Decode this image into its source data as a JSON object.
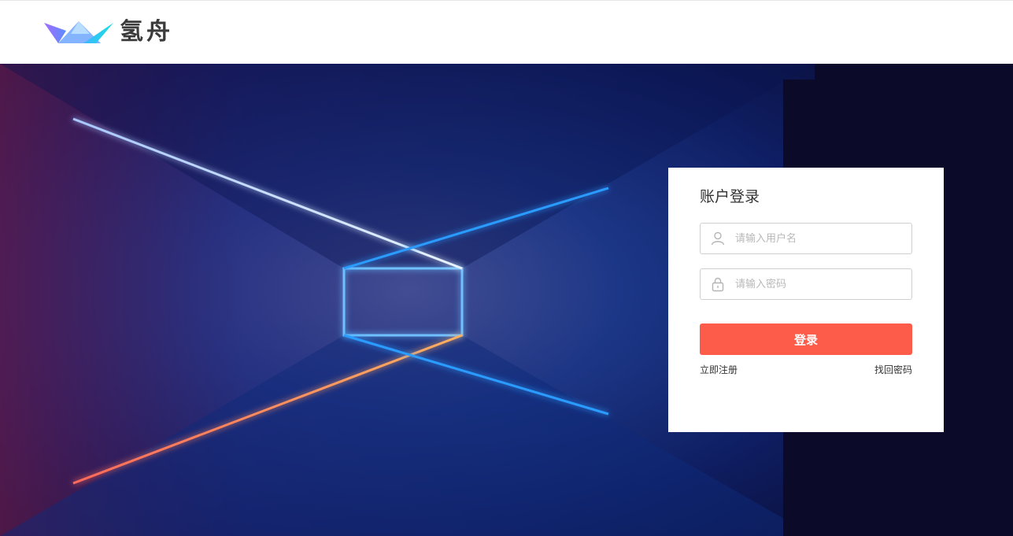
{
  "header": {
    "brand_name": "氢舟",
    "logo_icon": "paper-boat-logo"
  },
  "login": {
    "title": "账户登录",
    "username": {
      "placeholder": "请输入用户名",
      "value": "",
      "icon": "user-icon"
    },
    "password": {
      "placeholder": "请输入密码",
      "value": "",
      "icon": "lock-icon"
    },
    "submit_label": "登录",
    "register_link": "立即注册",
    "forgot_link": "找回密码"
  },
  "colors": {
    "accent": "#fe5c4b",
    "hero_background": "#0b0a28",
    "logo_purple": "#9d6bff",
    "logo_cyan": "#1fd8e8"
  }
}
